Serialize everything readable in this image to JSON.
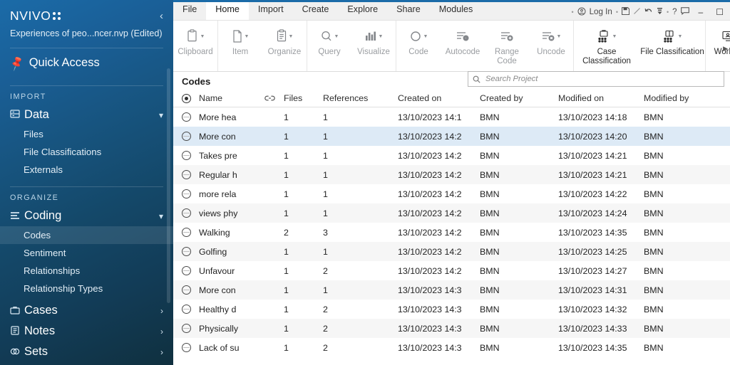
{
  "sidebar": {
    "logo": "NVIVO",
    "collapse_icon": "chevron-left-icon",
    "project_name": "Experiences of peo...ncer.nvp (Edited)",
    "quick_access": "Quick Access",
    "sections": [
      {
        "label": "IMPORT",
        "group": {
          "label": "Data",
          "icon": "database-icon",
          "chevron": "chevron-down-icon"
        },
        "items": [
          {
            "label": "Files",
            "active": false
          },
          {
            "label": "File Classifications",
            "active": false
          },
          {
            "label": "Externals",
            "active": false
          }
        ]
      },
      {
        "label": "ORGANIZE",
        "group": {
          "label": "Coding",
          "icon": "list-icon",
          "chevron": "chevron-down-icon"
        },
        "items": [
          {
            "label": "Codes",
            "active": true
          },
          {
            "label": "Sentiment",
            "active": false
          },
          {
            "label": "Relationships",
            "active": false
          },
          {
            "label": "Relationship Types",
            "active": false
          }
        ]
      }
    ],
    "collapsed_groups": [
      {
        "label": "Cases",
        "icon": "briefcase-icon",
        "chevron": "chevron-right-icon"
      },
      {
        "label": "Notes",
        "icon": "notebook-icon",
        "chevron": "chevron-right-icon"
      },
      {
        "label": "Sets",
        "icon": "sets-icon",
        "chevron": "chevron-right-icon"
      }
    ]
  },
  "ribbon": {
    "tabs": [
      {
        "label": "File",
        "active": false
      },
      {
        "label": "Home",
        "active": true
      },
      {
        "label": "Import",
        "active": false
      },
      {
        "label": "Create",
        "active": false
      },
      {
        "label": "Explore",
        "active": false
      },
      {
        "label": "Share",
        "active": false
      },
      {
        "label": "Modules",
        "active": false
      }
    ],
    "quick_access_toolbar": {
      "login_label": "Log In",
      "icons": [
        "user-circle-icon",
        "save-icon",
        "edit-pencil-icon",
        "undo-icon",
        "dropdown-arrow-icon",
        "help-icon",
        "comment-icon"
      ]
    },
    "window_controls": [
      "minimize-icon",
      "maximize-icon"
    ],
    "groups": [
      {
        "items": [
          {
            "label": "Clipboard",
            "icon": "clipboard-icon",
            "caret": true,
            "enabled": false
          }
        ]
      },
      {
        "items": [
          {
            "label": "Item",
            "icon": "document-icon",
            "caret": true,
            "enabled": false
          },
          {
            "label": "Organize",
            "icon": "organize-icon",
            "caret": true,
            "enabled": false
          }
        ]
      },
      {
        "items": [
          {
            "label": "Query",
            "icon": "search-icon",
            "caret": true,
            "enabled": false
          },
          {
            "label": "Visualize",
            "icon": "chart-icon",
            "caret": true,
            "enabled": false
          }
        ]
      },
      {
        "items": [
          {
            "label": "Code",
            "icon": "circle-icon",
            "caret": true,
            "enabled": false
          },
          {
            "label": "Autocode",
            "icon": "autocode-icon",
            "caret": false,
            "enabled": false
          },
          {
            "label": "Range Code",
            "icon": "rangecode-icon",
            "caret": false,
            "enabled": false
          },
          {
            "label": "Uncode",
            "icon": "uncode-icon",
            "caret": true,
            "enabled": false
          }
        ]
      },
      {
        "items": [
          {
            "label": "Case Classification",
            "icon": "case-classification-icon",
            "caret": true,
            "enabled": true
          },
          {
            "label": "File Classification",
            "icon": "file-classification-icon",
            "caret": true,
            "enabled": true
          }
        ]
      },
      {
        "items": [
          {
            "label": "Worksp",
            "icon": "workspace-icon",
            "caret": false,
            "enabled": true
          }
        ]
      }
    ]
  },
  "panel": {
    "title": "Codes"
  },
  "search": {
    "placeholder": "Search Project",
    "value": "",
    "icon": "search-icon"
  },
  "table": {
    "columns": [
      {
        "key": "sel",
        "label": "",
        "icon": "select-all-icon"
      },
      {
        "key": "name",
        "label": "Name"
      },
      {
        "key": "link",
        "label": "",
        "icon": "link-icon"
      },
      {
        "key": "files",
        "label": "Files"
      },
      {
        "key": "refs",
        "label": "References"
      },
      {
        "key": "con",
        "label": "Created on"
      },
      {
        "key": "cby",
        "label": "Created by"
      },
      {
        "key": "mon",
        "label": "Modified on"
      },
      {
        "key": "mby",
        "label": "Modified by"
      }
    ],
    "rows": [
      {
        "name": "More hea",
        "files": "1",
        "refs": "1",
        "created_on": "13/10/2023 14:1",
        "created_by": "BMN",
        "modified_on": "13/10/2023 14:18",
        "modified_by": "BMN",
        "selected": false
      },
      {
        "name": "More con",
        "files": "1",
        "refs": "1",
        "created_on": "13/10/2023 14:2",
        "created_by": "BMN",
        "modified_on": "13/10/2023 14:20",
        "modified_by": "BMN",
        "selected": true
      },
      {
        "name": "Takes pre",
        "files": "1",
        "refs": "1",
        "created_on": "13/10/2023 14:2",
        "created_by": "BMN",
        "modified_on": "13/10/2023 14:21",
        "modified_by": "BMN",
        "selected": false
      },
      {
        "name": "Regular h",
        "files": "1",
        "refs": "1",
        "created_on": "13/10/2023 14:2",
        "created_by": "BMN",
        "modified_on": "13/10/2023 14:21",
        "modified_by": "BMN",
        "selected": false
      },
      {
        "name": "more rela",
        "files": "1",
        "refs": "1",
        "created_on": "13/10/2023 14:2",
        "created_by": "BMN",
        "modified_on": "13/10/2023 14:22",
        "modified_by": "BMN",
        "selected": false
      },
      {
        "name": "views phy",
        "files": "1",
        "refs": "1",
        "created_on": "13/10/2023 14:2",
        "created_by": "BMN",
        "modified_on": "13/10/2023 14:24",
        "modified_by": "BMN",
        "selected": false
      },
      {
        "name": "Walking",
        "files": "2",
        "refs": "3",
        "created_on": "13/10/2023 14:2",
        "created_by": "BMN",
        "modified_on": "13/10/2023 14:35",
        "modified_by": "BMN",
        "selected": false
      },
      {
        "name": "Golfing",
        "files": "1",
        "refs": "1",
        "created_on": "13/10/2023 14:2",
        "created_by": "BMN",
        "modified_on": "13/10/2023 14:25",
        "modified_by": "BMN",
        "selected": false
      },
      {
        "name": "Unfavour",
        "files": "1",
        "refs": "2",
        "created_on": "13/10/2023 14:2",
        "created_by": "BMN",
        "modified_on": "13/10/2023 14:27",
        "modified_by": "BMN",
        "selected": false
      },
      {
        "name": "More con",
        "files": "1",
        "refs": "1",
        "created_on": "13/10/2023 14:3",
        "created_by": "BMN",
        "modified_on": "13/10/2023 14:31",
        "modified_by": "BMN",
        "selected": false
      },
      {
        "name": "Healthy d",
        "files": "1",
        "refs": "2",
        "created_on": "13/10/2023 14:3",
        "created_by": "BMN",
        "modified_on": "13/10/2023 14:32",
        "modified_by": "BMN",
        "selected": false
      },
      {
        "name": "Physically",
        "files": "1",
        "refs": "2",
        "created_on": "13/10/2023 14:3",
        "created_by": "BMN",
        "modified_on": "13/10/2023 14:33",
        "modified_by": "BMN",
        "selected": false
      },
      {
        "name": "Lack of su",
        "files": "1",
        "refs": "2",
        "created_on": "13/10/2023 14:3",
        "created_by": "BMN",
        "modified_on": "13/10/2023 14:35",
        "modified_by": "BMN",
        "selected": false
      }
    ]
  },
  "colors": {
    "brand_blue": "#1b6ba8",
    "sidebar_dark": "#10303f",
    "row_selected": "#ddeaf6",
    "row_alt": "#f6f6f6",
    "cursor_highlight": "#f2e800"
  },
  "cursor": {
    "highlight_icon": "cursor-highlight",
    "pointer_icon": "mouse-pointer-icon"
  }
}
